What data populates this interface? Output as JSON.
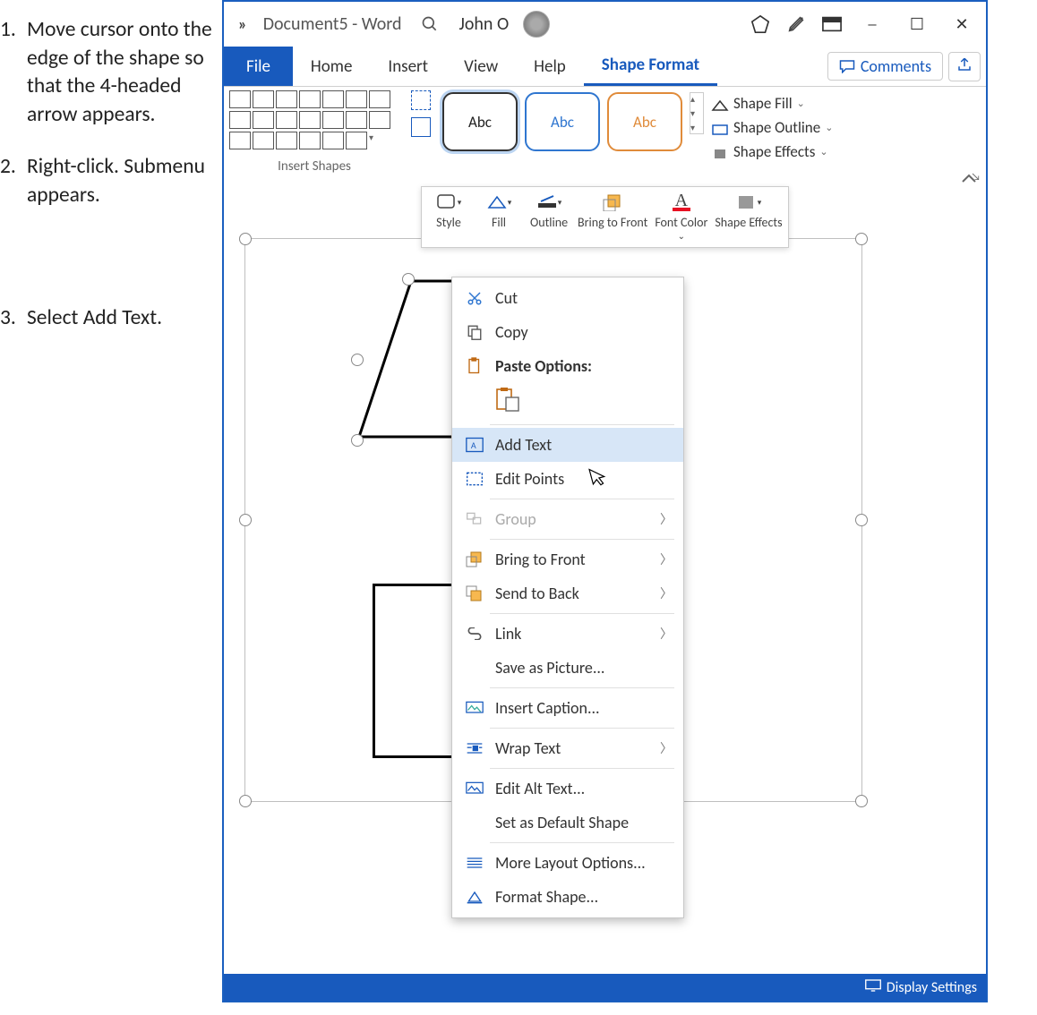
{
  "instructions": [
    "Move cursor onto the edge of the shape so that the 4-headed arrow appears.",
    "Right-click. Submenu appears.",
    "Select Add Text."
  ],
  "titlebar": {
    "doc_title": "Document5 - Word",
    "user_name": "John O"
  },
  "tabs": {
    "file": "File",
    "home": "Home",
    "insert": "Insert",
    "view": "View",
    "help": "Help",
    "shape_format": "Shape Format",
    "comments": "Comments"
  },
  "ribbon": {
    "insert_shapes": "Insert Shapes",
    "abc": "Abc",
    "shape_fill": "Shape Fill",
    "shape_outline": "Shape Outline",
    "shape_effects": "Shape Effects"
  },
  "mini_toolbar": {
    "style": "Style",
    "fill": "Fill",
    "outline": "Outline",
    "bring_to_front": "Bring to Front",
    "font_color": "Font Color",
    "shape_effects": "Shape Effects"
  },
  "context_menu": {
    "cut": "Cut",
    "copy": "Copy",
    "paste_options": "Paste Options:",
    "add_text": "Add Text",
    "edit_points": "Edit Points",
    "group": "Group",
    "bring_to_front": "Bring to Front",
    "send_to_back": "Send to Back",
    "link": "Link",
    "save_as_picture": "Save as Picture...",
    "insert_caption": "Insert Caption...",
    "wrap_text": "Wrap Text",
    "edit_alt_text": "Edit Alt Text...",
    "set_default": "Set as Default Shape",
    "more_layout": "More Layout Options...",
    "format_shape": "Format Shape..."
  },
  "statusbar": {
    "display_settings": "Display Settings"
  }
}
